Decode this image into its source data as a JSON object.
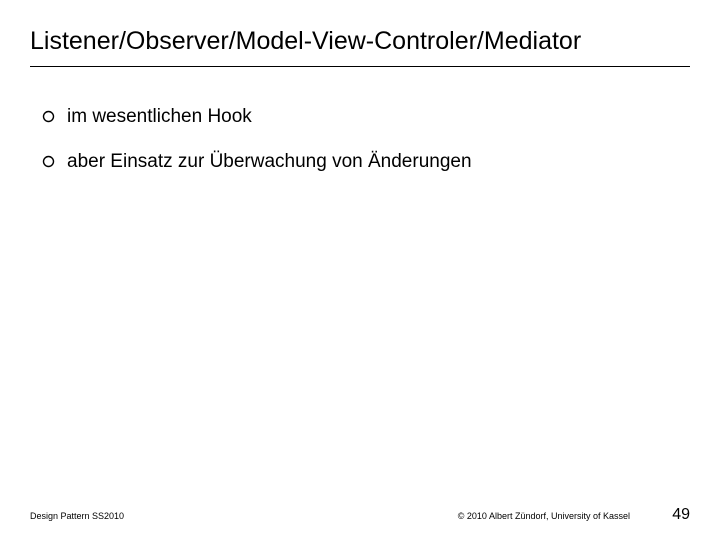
{
  "slide": {
    "title": "Listener/Observer/Model-View-Controler/Mediator",
    "bullets": [
      "im wesentlichen Hook",
      "aber Einsatz zur Überwachung von Änderungen"
    ]
  },
  "footer": {
    "left": "Design Pattern SS2010",
    "center": "© 2010 Albert Zündorf, University of Kassel",
    "pageNumber": "49"
  }
}
